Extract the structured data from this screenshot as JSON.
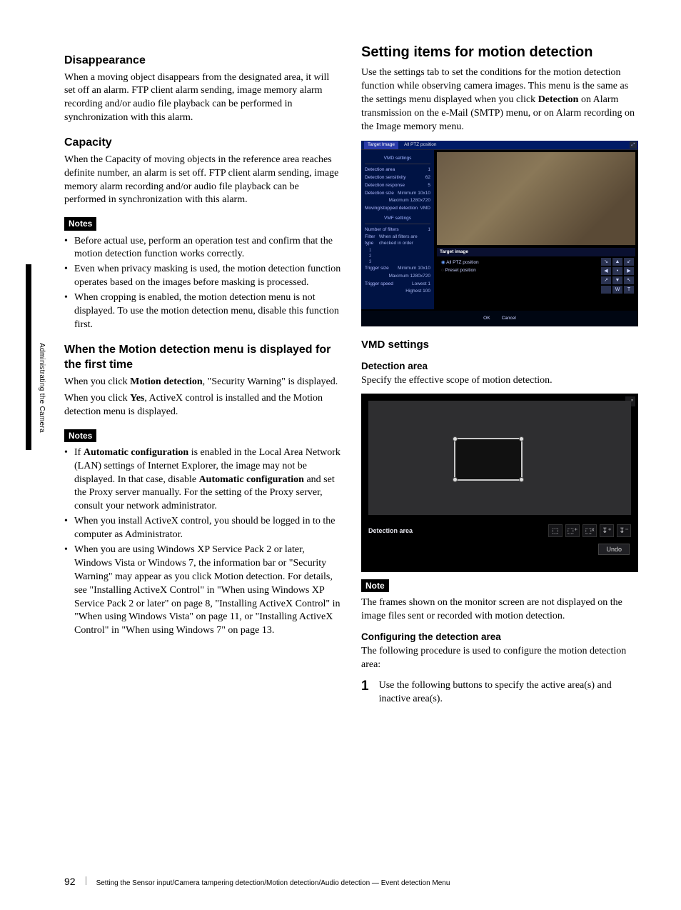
{
  "sideTab": "Administrating the Camera",
  "footer": {
    "pageNumber": "92",
    "text": "Setting the Sensor input/Camera tampering detection/Motion detection/Audio detection — Event detection Menu"
  },
  "left": {
    "h_disappearance": "Disappearance",
    "p_disappearance": "When a moving object disappears from the designated area, it will set off an alarm. FTP client alarm sending, image memory alarm recording and/or audio file playback can be performed in synchronization with this alarm.",
    "h_capacity": "Capacity",
    "p_capacity": "When the Capacity of moving objects in the reference area reaches definite number, an alarm is set off. FTP client alarm sending, image memory alarm recording and/or audio file playback can be performed in synchronization with this alarm.",
    "notes1_label": "Notes",
    "notes1": [
      "Before actual use, perform an operation test and confirm that the motion detection function works correctly.",
      "Even when privacy masking is used, the motion detection function operates based on the images before masking is processed.",
      "When cropping is enabled, the motion detection menu is not displayed. To use the motion detection menu, disable this function first."
    ],
    "h_firsttime": "When the Motion detection menu is displayed for the first time",
    "p_firsttime_a_pre": "When you click ",
    "p_firsttime_a_bold": "Motion detection",
    "p_firsttime_a_post": ", \"Security Warning\" is displayed.",
    "p_firsttime_b_pre": "When you click ",
    "p_firsttime_b_bold": "Yes",
    "p_firsttime_b_post": ", ActiveX control is installed and the Motion detection menu is displayed.",
    "notes2_label": "Notes",
    "notes2_item1_pre": "If ",
    "notes2_item1_b1": "Automatic configuration",
    "notes2_item1_mid": " is enabled in the Local Area Network (LAN) settings of Internet Explorer, the image may not be displayed. In that case, disable ",
    "notes2_item1_b2": "Automatic configuration",
    "notes2_item1_post": " and set the Proxy server manually. For the setting of the Proxy server, consult your network administrator.",
    "notes2_item2": "When you install ActiveX control, you should be logged in to the computer as Administrator.",
    "notes2_item3": "When you are using Windows XP Service Pack 2 or later, Windows Vista or Windows 7, the information bar or \"Security Warning\" may appear as you click Motion detection. For details, see \"Installing ActiveX Control\" in \"When using Windows XP Service Pack 2 or later\" on page 8, \"Installing ActiveX Control\" in \"When using Windows Vista\" on page 11, or \"Installing ActiveX Control\" in \"When using Windows 7\" on page 13."
  },
  "right": {
    "h_main": "Setting items for motion detection",
    "p_intro_pre": "Use the settings tab to set the conditions for the motion detection function while observing camera images. This menu is the same as the settings menu displayed when you click ",
    "p_intro_bold": "Detection",
    "p_intro_post": " on Alarm transmission on the e-Mail (SMTP) menu, or on Alarm recording on the Image memory menu.",
    "shot1": {
      "tab_target": "Target Image",
      "tab_ptz": "All PTZ position",
      "sect_vmd": "VMD settings",
      "rows_vmd": [
        {
          "k": "Detection area",
          "v": "1"
        },
        {
          "k": "Detection sensitivity",
          "v": "62"
        },
        {
          "k": "Detection response",
          "v": "5"
        },
        {
          "k": "Detection size",
          "v": "Minimum 10x10"
        },
        {
          "k": "",
          "v": "Maximum 1280x720"
        },
        {
          "k": "Moving/stopped detection",
          "v": "VMD"
        }
      ],
      "sect_vmf": "VMF settings",
      "rows_vmf": [
        {
          "k": "Number of filters",
          "v": "1"
        },
        {
          "k": "Filter type",
          "v": "When all filters are checked in order"
        }
      ],
      "row_filter_nums": [
        "1",
        "2",
        "3"
      ],
      "rows_trigger": [
        {
          "k": "Trigger size",
          "v": "Minimum 10x10"
        },
        {
          "k": "",
          "v": "Maximum 1280x720"
        },
        {
          "k": "Trigger speed",
          "v": "Lowest 1"
        },
        {
          "k": "",
          "v": "Highest 100"
        }
      ],
      "targetbar": "Target image",
      "radio_all": "All PTZ position",
      "radio_preset": "Preset position",
      "ok": "OK",
      "cancel": "Cancel",
      "pad": [
        "↘",
        "▲",
        "↙",
        "◀",
        "•",
        "▶",
        "↗",
        "▼",
        "↖"
      ],
      "wt": [
        "W",
        "T"
      ]
    },
    "h_vmd": "VMD settings",
    "h_detarea": "Detection area",
    "p_detarea": "Specify the effective scope of motion detection.",
    "shot2": {
      "label": "Detection area",
      "undo": "Undo",
      "icons": [
        "⬚",
        "⬚⁺",
        "⬚ˣ",
        "↧⁺",
        "↧⁻"
      ]
    },
    "note_label": "Note",
    "p_note": "The frames shown on the monitor screen are not displayed on the image files sent or recorded with motion detection.",
    "h_config": "Configuring the detection area",
    "p_config": "The following procedure is used to configure the motion detection area:",
    "step1_num": "1",
    "step1_text": "Use the following buttons to specify the active area(s) and inactive area(s)."
  }
}
